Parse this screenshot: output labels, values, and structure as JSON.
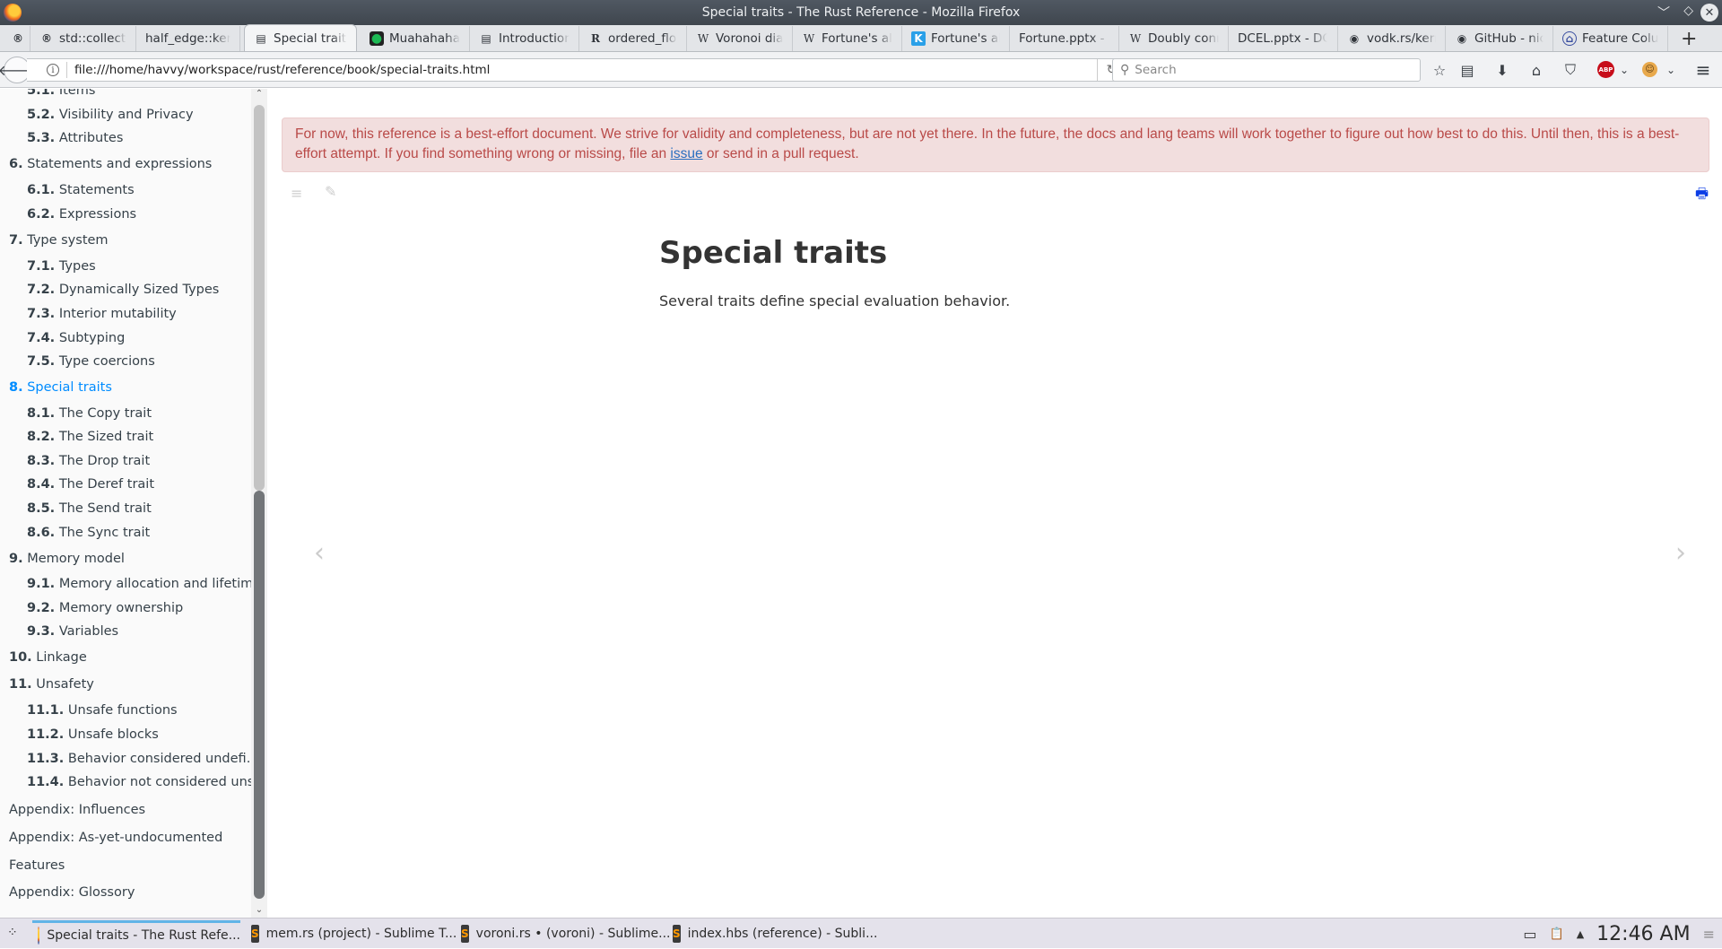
{
  "window": {
    "title": "Special traits - The Rust Reference - Mozilla Firefox",
    "controls": {
      "minimize": "﹀",
      "maximize": "◇",
      "close": "✕"
    }
  },
  "tabs": [
    {
      "label": "",
      "icon": "rust-icon",
      "glyph": "®",
      "pinned": true
    },
    {
      "label": "std::collectio",
      "icon": "rust-icon",
      "glyph": "®"
    },
    {
      "label": "half_edge::kerne",
      "icon": "",
      "glyph": ""
    },
    {
      "label": "Special traits",
      "icon": "book-icon",
      "glyph": "▤",
      "active": true
    },
    {
      "label": "Muahahaha",
      "icon": "green-dot-icon",
      "glyph": "●"
    },
    {
      "label": "Introduction",
      "icon": "book-icon",
      "glyph": "▤"
    },
    {
      "label": "ordered_floa",
      "icon": "rust-crate-icon",
      "glyph": "R"
    },
    {
      "label": "Voronoi diag",
      "icon": "wikipedia-icon",
      "glyph": "W"
    },
    {
      "label": "Fortune's alg",
      "icon": "wikipedia-icon",
      "glyph": "W"
    },
    {
      "label": "Fortune's alg",
      "icon": "k-icon",
      "glyph": "K"
    },
    {
      "label": "Fortune.pptx - F",
      "icon": "",
      "glyph": ""
    },
    {
      "label": "Doubly conn",
      "icon": "wikipedia-icon",
      "glyph": "W"
    },
    {
      "label": "DCEL.pptx - DCE",
      "icon": "",
      "glyph": ""
    },
    {
      "label": "vodk.rs/kern",
      "icon": "github-icon",
      "glyph": "◉"
    },
    {
      "label": "GitHub - nica",
      "icon": "github-icon",
      "glyph": "◉"
    },
    {
      "label": "Feature Colu",
      "icon": "institution-icon",
      "glyph": "⌂"
    }
  ],
  "new_tab": "+",
  "navbar": {
    "back": "🡐",
    "url": "file:///home/havvy/workspace/rust/reference/book/special-traits.html",
    "reload": "↻",
    "search_placeholder": "Search",
    "icons": {
      "bookmark": "☆",
      "reader": "▤",
      "download": "⬇",
      "home": "⌂",
      "pocket": "⛉",
      "abp": "ABP",
      "dropdown": "⌄",
      "monkey": "☺",
      "menu": "≡"
    }
  },
  "sidebar": {
    "items": [
      {
        "num": "5.1.",
        "label": "Items",
        "level": 2
      },
      {
        "num": "5.2.",
        "label": "Visibility and Privacy",
        "level": 2
      },
      {
        "num": "5.3.",
        "label": "Attributes",
        "level": 2
      },
      {
        "num": "6.",
        "label": "Statements and expressions",
        "level": 1
      },
      {
        "num": "6.1.",
        "label": "Statements",
        "level": 2
      },
      {
        "num": "6.2.",
        "label": "Expressions",
        "level": 2
      },
      {
        "num": "7.",
        "label": "Type system",
        "level": 1
      },
      {
        "num": "7.1.",
        "label": "Types",
        "level": 2
      },
      {
        "num": "7.2.",
        "label": "Dynamically Sized Types",
        "level": 2
      },
      {
        "num": "7.3.",
        "label": "Interior mutability",
        "level": 2
      },
      {
        "num": "7.4.",
        "label": "Subtyping",
        "level": 2
      },
      {
        "num": "7.5.",
        "label": "Type coercions",
        "level": 2
      },
      {
        "num": "8.",
        "label": "Special traits",
        "level": 1,
        "active": true
      },
      {
        "num": "8.1.",
        "label": "The Copy trait",
        "level": 2
      },
      {
        "num": "8.2.",
        "label": "The Sized trait",
        "level": 2
      },
      {
        "num": "8.3.",
        "label": "The Drop trait",
        "level": 2
      },
      {
        "num": "8.4.",
        "label": "The Deref trait",
        "level": 2
      },
      {
        "num": "8.5.",
        "label": "The Send trait",
        "level": 2
      },
      {
        "num": "8.6.",
        "label": "The Sync trait",
        "level": 2
      },
      {
        "num": "9.",
        "label": "Memory model",
        "level": 1
      },
      {
        "num": "9.1.",
        "label": "Memory allocation and lifetime",
        "level": 2
      },
      {
        "num": "9.2.",
        "label": "Memory ownership",
        "level": 2
      },
      {
        "num": "9.3.",
        "label": "Variables",
        "level": 2
      },
      {
        "num": "10.",
        "label": "Linkage",
        "level": 1
      },
      {
        "num": "11.",
        "label": "Unsafety",
        "level": 1
      },
      {
        "num": "11.1.",
        "label": "Unsafe functions",
        "level": 2
      },
      {
        "num": "11.2.",
        "label": "Unsafe blocks",
        "level": 2
      },
      {
        "num": "11.3.",
        "label": "Behavior considered undefi…",
        "level": 2
      },
      {
        "num": "11.4.",
        "label": "Behavior not considered uns…",
        "level": 2
      },
      {
        "num": "",
        "label": "Appendix: Influences",
        "level": 1
      },
      {
        "num": "",
        "label": "Appendix: As-yet-undocumented",
        "level": 1
      },
      {
        "num": "",
        "label": "Features",
        "level": 1
      },
      {
        "num": "",
        "label": "Appendix: Glossory",
        "level": 1
      }
    ]
  },
  "content": {
    "warning": {
      "text_before": "For now, this reference is a best-effort document. We strive for validity and completeness, but are not yet there. In the future, the docs and lang teams will work together to figure out how best to do this. Until then, this is a best-effort attempt. If you find something wrong or missing, file an ",
      "link": "issue",
      "text_after": " or send in a pull request."
    },
    "title": "Special traits",
    "body": "Several traits define special evaluation behavior.",
    "prev": "‹",
    "next": "›",
    "menu_icon": "≡",
    "brush_icon": "✎",
    "print_icon": "🖶"
  },
  "taskbar": {
    "launcher": "⁘",
    "tasks": [
      {
        "label": "Special traits - The Rust Refe...",
        "app": "firefox",
        "active": true
      },
      {
        "label": "mem.rs (project) - Sublime T...",
        "app": "sublime"
      },
      {
        "label": "voroni.rs • (voroni) - Sublime...",
        "app": "sublime"
      },
      {
        "label": "index.hbs (reference) - Subli...",
        "app": "sublime"
      }
    ],
    "tray": {
      "battery": "▭",
      "clipboard": "📋",
      "expand": "▲",
      "clock": "12:46 AM",
      "menu": "≡"
    }
  }
}
